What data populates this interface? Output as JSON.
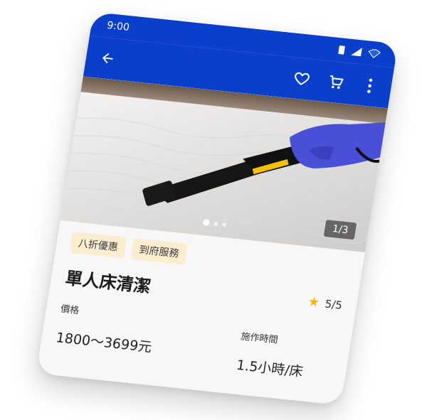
{
  "statusbar": {
    "time": "9:00"
  },
  "appbar": {
    "back_icon": "arrow-left-icon",
    "favorite_icon": "heart-outline-icon",
    "cart_icon": "shopping-cart-icon",
    "menu_icon": "more-vert-icon"
  },
  "hero": {
    "page_indicator": "1/3",
    "dots_count": 3,
    "active_dot": 1
  },
  "product": {
    "tags": [
      "八折優惠",
      "到府服務"
    ],
    "title": "單人床清潔",
    "rating": "5/5",
    "price_label": "價格",
    "price_value": "1800～3699元",
    "duration_label": "施作時間",
    "duration_value": "1.5小時/床"
  },
  "colors": {
    "primary": "#0a3fcc",
    "tag_bg": "#fbeed0",
    "star": "#f5b800"
  }
}
